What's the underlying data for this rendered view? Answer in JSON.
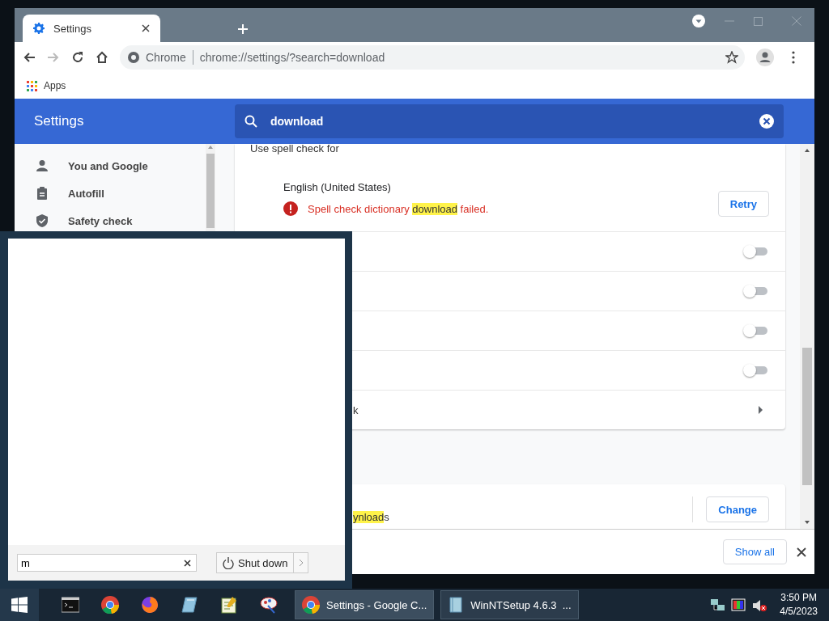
{
  "browser": {
    "tabs": [
      {
        "title": "Settings",
        "selected": true
      }
    ],
    "omnibox": {
      "site_label": "Chrome",
      "url": "chrome://settings/?search=download"
    },
    "bookmarks": [
      "Apps"
    ],
    "settings": {
      "title": "Settings",
      "search": {
        "value": "download"
      },
      "sidebar": [
        {
          "label": "You and Google"
        },
        {
          "label": "Autofill"
        },
        {
          "label": "Safety check"
        }
      ],
      "section_label": "Use spell check for",
      "language": {
        "name": "English (United States)",
        "error": {
          "before": "Spell check dictionary ",
          "highlight": "download",
          "after": " failed."
        },
        "button": "Retry"
      },
      "toggles": [
        {
          "on": false
        },
        {
          "on": false
        },
        {
          "on": false
        },
        {
          "on": false
        }
      ],
      "link_row": {
        "text": "k"
      },
      "downloads_row": {
        "highlight": "ynload",
        "after": "s",
        "button": "Change"
      }
    },
    "download_bar": {
      "button": "Show all"
    }
  },
  "start_menu": {
    "search": {
      "value": "m"
    },
    "shutdown": "Shut down"
  },
  "taskbar": {
    "windows": [
      {
        "title": "Settings - Google C...",
        "selected": true
      },
      {
        "title": "WinNTSetup 4.6.3  ...",
        "selected": false
      }
    ],
    "clock": {
      "time": "3:50 PM",
      "date": "4/5/2023"
    }
  }
}
